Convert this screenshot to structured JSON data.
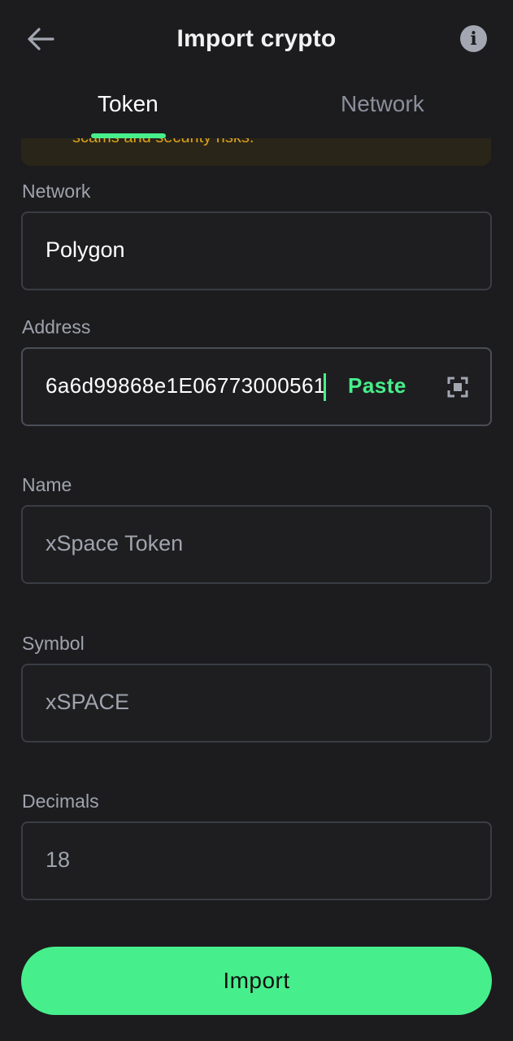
{
  "header": {
    "title": "Import crypto",
    "back_icon": "arrow-left-icon",
    "info_icon": "info-icon",
    "info_glyph": "i"
  },
  "tabs": [
    {
      "label": "Token",
      "active": true
    },
    {
      "label": "Network",
      "active": false
    }
  ],
  "warning": {
    "text": "scams and security risks."
  },
  "form": {
    "network": {
      "label": "Network",
      "value": "Polygon"
    },
    "address": {
      "label": "Address",
      "value": "6a6d99868e1E06773000561",
      "paste_label": "Paste",
      "scan_icon": "scan-icon"
    },
    "name": {
      "label": "Name",
      "value": "xSpace Token"
    },
    "symbol": {
      "label": "Symbol",
      "value": "xSPACE"
    },
    "decimals": {
      "label": "Decimals",
      "value": "18"
    }
  },
  "actions": {
    "import_label": "Import"
  },
  "colors": {
    "background": "#1c1c1e",
    "accent": "#47ef8c",
    "warning_text": "#d9a21a",
    "muted_text": "#9fa3ad"
  }
}
